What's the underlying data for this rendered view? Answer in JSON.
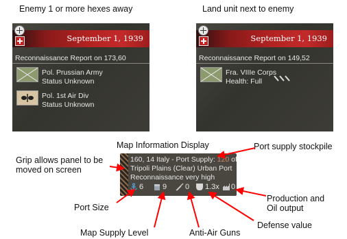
{
  "captions": {
    "left": "Enemy 1 or more hexes away",
    "right": "Land unit next to enemy"
  },
  "panels": [
    {
      "date": "September 1, 1939",
      "report": "Reconnaissance Report on 173,60",
      "units": [
        {
          "icon": "infantry-icon",
          "line1": "Pol. Prussian Army",
          "line2": "Status Unknown"
        },
        {
          "icon": "aircraft-icon",
          "line1": "Pol. 1st Air Div",
          "line2": "Status Unknown"
        }
      ]
    },
    {
      "date": "September 1, 1939",
      "report": "Reconnaissance Report on 149,52",
      "units": [
        {
          "icon": "infantry-icon",
          "line1": "Fra. VIIIe Corps",
          "line2": "Health: Full"
        }
      ]
    }
  ],
  "map_info": {
    "title": "Map Information Display",
    "line1_prefix": "160, 14 Italy - Port Supply: ",
    "line1_stock": "120",
    "line1_suffix": " of 120",
    "line2": "Tripoli  Plains (Clear)  Urban Port",
    "line3": "Reconnaissance very high",
    "stats": {
      "port_size": "6",
      "supply": "9",
      "aa": "0",
      "defense": "1.3x",
      "production": "0"
    }
  },
  "annotations": {
    "grip": "Grip allows panel to be moved on screen",
    "grip_line1": "Grip allows panel to be",
    "grip_line2": "moved on screen",
    "port_stock": "Port supply stockpile",
    "port_size": "Port Size",
    "map_supply": "Map Supply Level",
    "aa_guns": "Anti-Air Guns",
    "defense": "Defense value",
    "production_line1": "Production and",
    "production_line2": "Oil output"
  },
  "colors": {
    "arrow": "#ff0000",
    "header_red": "#b32222",
    "panel_bg": "#3a3a34",
    "stockpile_text": "#d58a6a"
  }
}
